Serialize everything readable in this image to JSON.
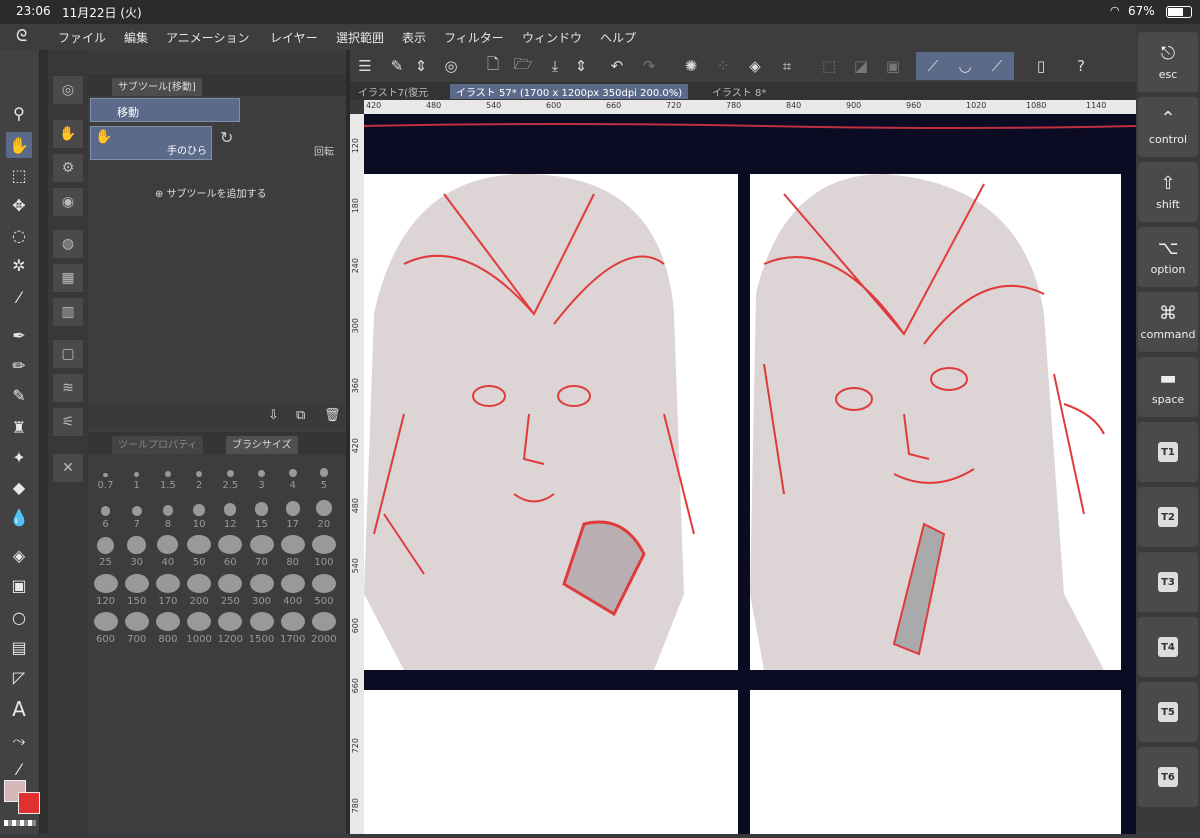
{
  "status": {
    "time": "23:06",
    "date": "11月22日 (火)",
    "battery": "67%"
  },
  "menu": [
    "ファイル",
    "編集",
    "アニメーション",
    "レイヤー",
    "選択範囲",
    "表示",
    "フィルター",
    "ウィンドウ",
    "ヘルプ"
  ],
  "subtool_panel": {
    "title": "サブツール[移動]",
    "group": "移動",
    "items": [
      {
        "label": "手のひら"
      },
      {
        "label": "回転"
      }
    ],
    "add_label": "サブツールを追加する"
  },
  "brush_panel": {
    "tabs": [
      "ツールプロパティ",
      "ブラシサイズ"
    ],
    "sizes": [
      "0.7",
      "1",
      "1.5",
      "2",
      "2.5",
      "3",
      "4",
      "5",
      "6",
      "7",
      "8",
      "10",
      "12",
      "15",
      "17",
      "20",
      "25",
      "30",
      "40",
      "50",
      "60",
      "70",
      "80",
      "100",
      "120",
      "150",
      "170",
      "200",
      "250",
      "300",
      "400",
      "500",
      "600",
      "700",
      "800",
      "1000",
      "1200",
      "1500",
      "1700",
      "2000"
    ]
  },
  "doc_tabs": [
    "イラスト7(復元",
    "イラスト 57* (1700 x 1200px 350dpi 200.0%)",
    "イラスト 8*"
  ],
  "ruler_h": [
    "420",
    "480",
    "540",
    "600",
    "660",
    "720",
    "780",
    "840",
    "900",
    "960",
    "1020",
    "1080",
    "1140"
  ],
  "ruler_v": [
    "120",
    "180",
    "240",
    "300",
    "360",
    "420",
    "480",
    "540",
    "600",
    "660",
    "720",
    "780"
  ],
  "right_keys": [
    {
      "label": "esc",
      "icon": "esc-icon"
    },
    {
      "label": "control",
      "icon": "caret-up-icon"
    },
    {
      "label": "shift",
      "icon": "shift-icon"
    },
    {
      "label": "option",
      "icon": "option-icon"
    },
    {
      "label": "command",
      "icon": "command-icon"
    },
    {
      "label": "space",
      "icon": "space-icon"
    },
    {
      "label": "T1"
    },
    {
      "label": "T2"
    },
    {
      "label": "T3"
    },
    {
      "label": "T4"
    },
    {
      "label": "T5"
    },
    {
      "label": "T6"
    }
  ],
  "colors": {
    "main": "#d7b8b8",
    "sub": "#e03030",
    "accent": "#5c6a8a"
  }
}
